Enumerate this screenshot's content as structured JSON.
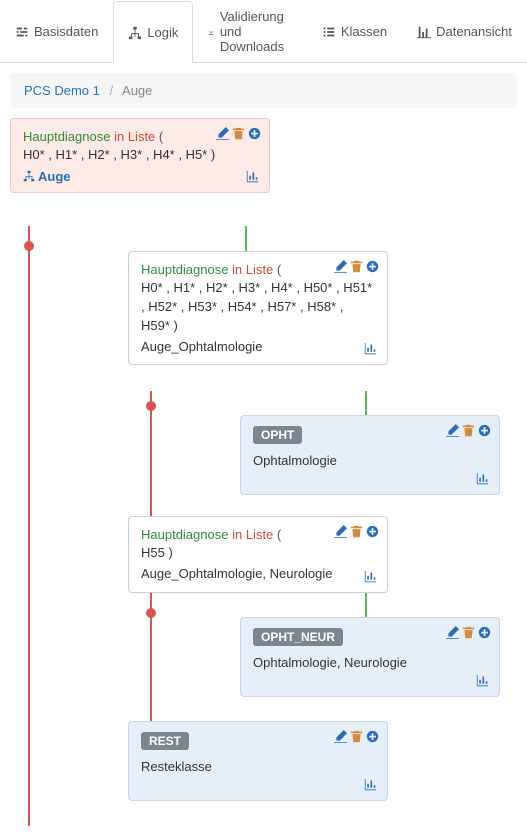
{
  "tabs": [
    {
      "label": "Basisdaten"
    },
    {
      "label": "Logik"
    },
    {
      "label": "Validierung und Downloads"
    },
    {
      "label": "Klassen"
    },
    {
      "label": "Datenansicht"
    }
  ],
  "breadcrumb": {
    "root": "PCS Demo 1",
    "current": "Auge"
  },
  "nodes": {
    "root": {
      "hd": "Hauptdiagnose",
      "inlist": "in Liste",
      "paren_open": "(",
      "codes": "H0* , H1* , H2* , H3* , H4* , H5* )",
      "link": "Auge"
    },
    "n1": {
      "hd": "Hauptdiagnose",
      "inlist": "in Liste",
      "paren_open": "(",
      "codes": "H0* , H1* , H2* , H3* , H4* , H50* , H51* , H52* , H53* , H54* , H57* , H58* , H59* )",
      "label": "Auge_Ophtalmologie"
    },
    "t1": {
      "badge": "OPHT",
      "label": "Ophtalmologie"
    },
    "n2": {
      "hd": "Hauptdiagnose",
      "inlist": "in Liste",
      "paren_open": "(",
      "codes": "H55 )",
      "label": "Auge_Ophtalmologie, Neurologie"
    },
    "t2": {
      "badge": "OPHT_NEUR",
      "label": "Ophtalmologie, Neurologie"
    },
    "t3": {
      "badge": "REST",
      "label": "Resteklasse"
    }
  }
}
